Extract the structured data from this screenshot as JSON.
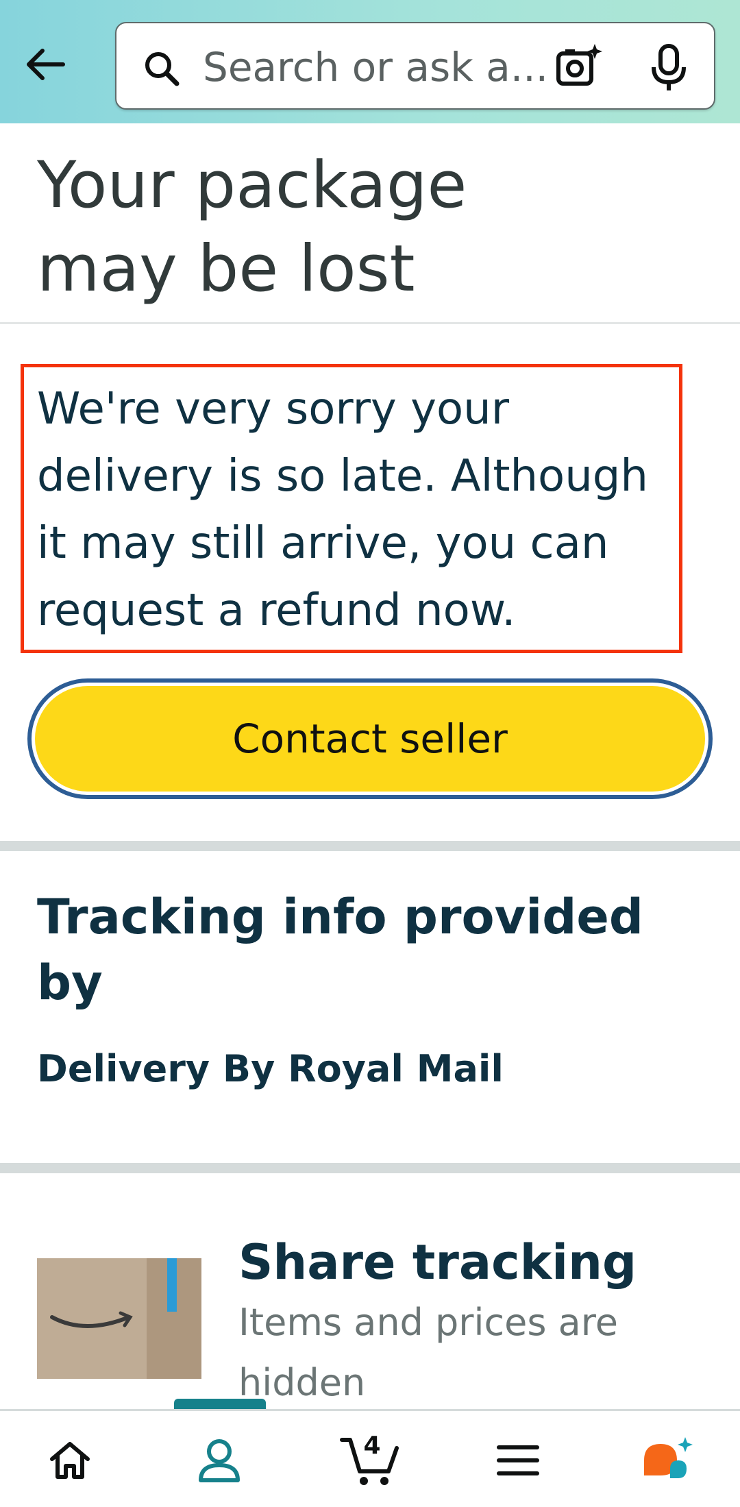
{
  "header": {
    "search_placeholder": "Search or ask a..."
  },
  "page": {
    "title_line1": "Your package",
    "title_line2": "may be lost",
    "message": "We're very sorry your delivery is so late. Although it may still arrive, you can request a refund now.",
    "contact_button_label": "Contact seller"
  },
  "tracking": {
    "title": "Tracking info provided by",
    "carrier": "Delivery By Royal Mail"
  },
  "share": {
    "title": "Share tracking",
    "subtitle": "Items and prices are hidden"
  },
  "bottom_nav": {
    "items": [
      {
        "icon": "home-icon"
      },
      {
        "icon": "account-icon",
        "active": true
      },
      {
        "icon": "cart-icon",
        "count": "4"
      },
      {
        "icon": "menu-icon"
      },
      {
        "icon": "rufus-assistant-icon"
      }
    ],
    "cart_count": "4"
  },
  "colors": {
    "header_gradient_start": "#86d4dc",
    "header_gradient_end": "#aee6d4",
    "button_yellow": "#fdd818",
    "focus_ring": "#2d5d95",
    "highlight_border": "#f4330c",
    "active_teal": "#16818b",
    "heading_navy": "#0f3142"
  }
}
